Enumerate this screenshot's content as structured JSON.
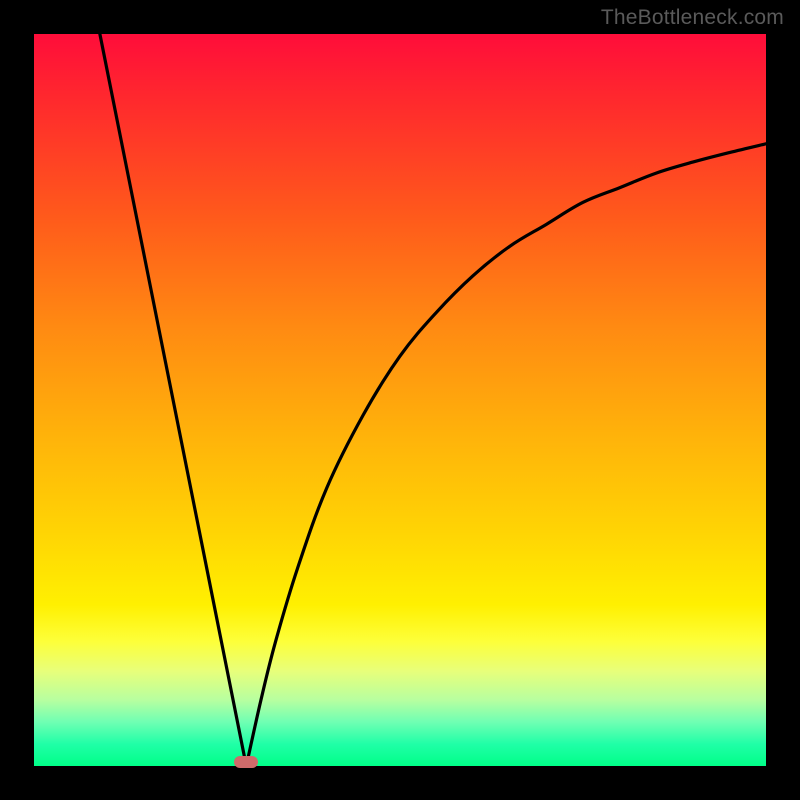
{
  "watermark": "TheBottleneck.com",
  "colors": {
    "frame": "#000000",
    "curve": "#000000",
    "marker": "#cf6a6a",
    "gradient_top": "#ff0d3a",
    "gradient_bottom": "#00ff88"
  },
  "chart_data": {
    "type": "line",
    "title": "",
    "xlabel": "",
    "ylabel": "",
    "xlim": [
      0,
      100
    ],
    "ylim": [
      0,
      100
    ],
    "grid": false,
    "legend": false,
    "notes": "V-shaped bottleneck curve. Axes are unlabeled; values are estimated from geometry on a 0–100 normalized scale. Vertical axis likely represents bottleneck percentage (0 at bottom, ~100 at top). Minimum of the curve is near x≈29.",
    "series": [
      {
        "name": "left-branch",
        "x": [
          9,
          12,
          15,
          18,
          21,
          24,
          27,
          29
        ],
        "values": [
          100,
          85,
          70,
          55,
          40,
          25,
          10,
          0
        ]
      },
      {
        "name": "right-branch",
        "x": [
          29,
          31,
          33,
          36,
          40,
          45,
          50,
          55,
          60,
          65,
          70,
          75,
          80,
          85,
          90,
          95,
          100
        ],
        "values": [
          0,
          9,
          17,
          27,
          38,
          48,
          56,
          62,
          67,
          71,
          74,
          77,
          79,
          81,
          82.5,
          83.8,
          85
        ]
      }
    ],
    "marker": {
      "x": 29,
      "y": 0
    }
  }
}
